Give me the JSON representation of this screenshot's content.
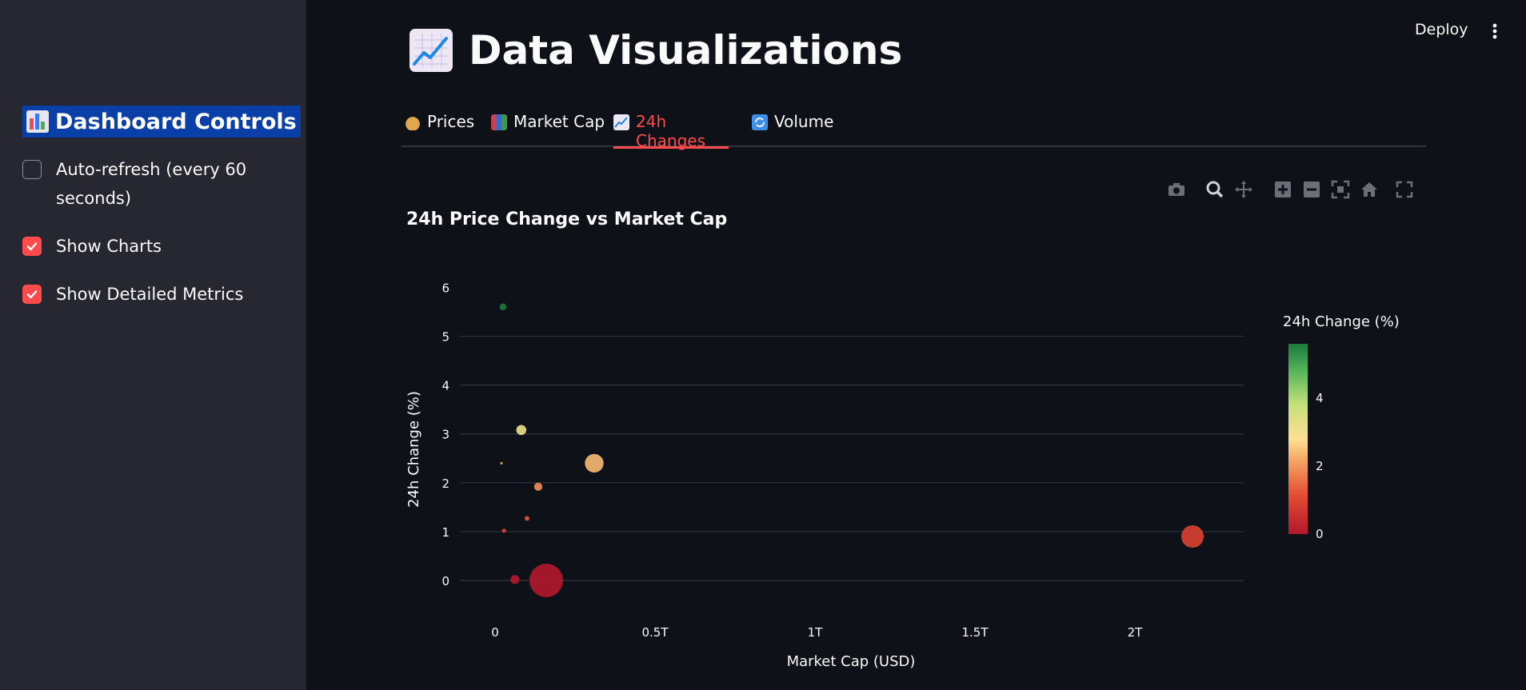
{
  "sidebar": {
    "title": "Dashboard Controls",
    "checkboxes": [
      {
        "label": "Auto-refresh (every 60",
        "label2": "seconds)",
        "checked": false
      },
      {
        "label": "Show Charts",
        "checked": true
      },
      {
        "label": "Show Detailed Metrics",
        "checked": true
      }
    ]
  },
  "header": {
    "deploy_label": "Deploy",
    "page_title": "Data Visualizations"
  },
  "tabs": [
    {
      "label": "Prices",
      "icon": "money-bag-icon",
      "active": false
    },
    {
      "label": "Market Cap",
      "icon": "bar-chart-icon",
      "active": false
    },
    {
      "label": "24h Changes",
      "icon": "chart-increasing-icon",
      "active": true
    },
    {
      "label": "Volume",
      "icon": "refresh-icon",
      "active": false
    }
  ],
  "colors": {
    "accent": "#ff4b4b",
    "sidebar_bg": "#262730",
    "main_bg": "#0e1117"
  },
  "chart_data": {
    "type": "scatter",
    "title": "24h Price Change vs Market Cap",
    "xlabel": "Market Cap (USD)",
    "ylabel": "24h Change (%)",
    "xlim": [
      -0.11,
      2.34
    ],
    "ylim": [
      -0.9,
      6.4
    ],
    "x_ticks": [
      {
        "v": 0,
        "label": "0"
      },
      {
        "v": 0.5,
        "label": "0.5T"
      },
      {
        "v": 1,
        "label": "1T"
      },
      {
        "v": 1.5,
        "label": "1.5T"
      },
      {
        "v": 2,
        "label": "2T"
      }
    ],
    "y_ticks": [
      0,
      1,
      2,
      3,
      4,
      5,
      6
    ],
    "x_unit": "trillion USD",
    "grid": true,
    "colorbar": {
      "title": "24h Change (%)",
      "ticks": [
        0,
        2,
        4
      ],
      "range": [
        0,
        5.6
      ],
      "colorscale": "RdYlGn"
    },
    "points": [
      {
        "x": 0.025,
        "y": 5.6,
        "size": 0.04
      },
      {
        "x": 0.082,
        "y": 3.08,
        "size": 0.09
      },
      {
        "x": 0.31,
        "y": 2.4,
        "size": 0.31
      },
      {
        "x": 0.02,
        "y": 2.4,
        "size": 0.005
      },
      {
        "x": 0.135,
        "y": 1.92,
        "size": 0.06
      },
      {
        "x": 0.1,
        "y": 1.27,
        "size": 0.02
      },
      {
        "x": 0.028,
        "y": 1.02,
        "size": 0.015
      },
      {
        "x": 2.18,
        "y": 0.9,
        "size": 0.45
      },
      {
        "x": 0.062,
        "y": 0.02,
        "size": 0.07
      },
      {
        "x": 0.16,
        "y": 0.0,
        "size": 1.0
      }
    ]
  }
}
